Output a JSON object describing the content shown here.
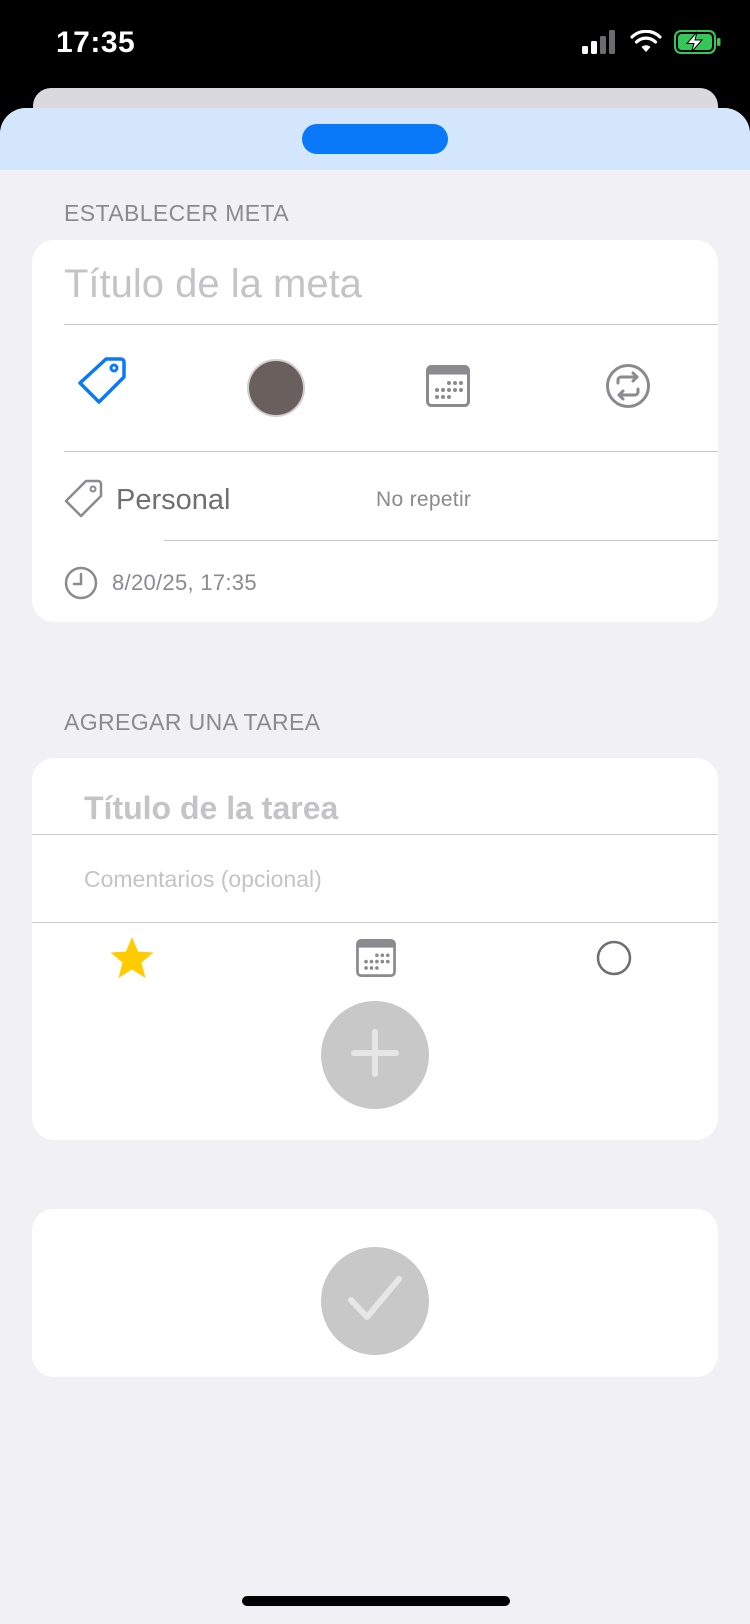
{
  "status_bar": {
    "time": "17:35",
    "icons": [
      "signal-icon",
      "wifi-icon",
      "battery-charging-icon"
    ],
    "battery_color": "#35c759"
  },
  "sheet": {
    "header_color": "#d3e6fc",
    "grabber_color": "#0a79f9"
  },
  "goal_section": {
    "label": "ESTABLECER META",
    "title_placeholder": "Título de la meta",
    "toolbar_icons": [
      "tag-icon",
      "color-swatch",
      "calendar-icon",
      "repeat-icon"
    ],
    "selected_color": "#6a5f5c",
    "accent_color": "#0a79f9",
    "category": "Personal",
    "repeat": "No repetir",
    "date": "8/20/25, 17:35"
  },
  "task_section": {
    "label": "AGREGAR UNA TAREA",
    "title_placeholder": "Título de la tarea",
    "comment_placeholder": "Comentarios (opcional)",
    "toolbar_icons": [
      "star-icon",
      "calendar-icon",
      "circle-icon"
    ],
    "star_color": "#ffcc00",
    "add_button_icon": "plus-icon"
  },
  "confirm": {
    "button_icon": "checkmark-icon"
  }
}
